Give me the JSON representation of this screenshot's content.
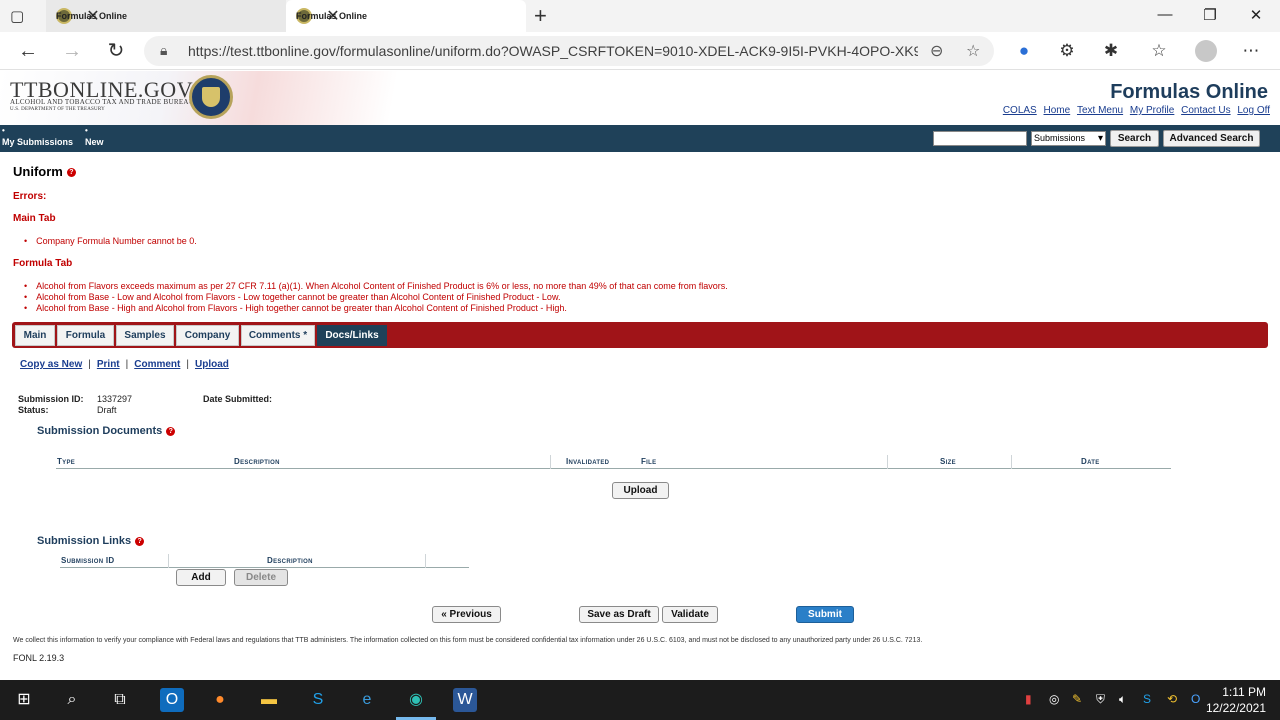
{
  "browser": {
    "tabs": [
      {
        "title": "Formulas Online"
      },
      {
        "title": "Formulas Online"
      }
    ],
    "url": "https://test.ttbonline.gov/formulasonline/uniform.do?OWASP_CSRFTOKEN=9010-XDEL-ACK9-9I5I-PVKH-4OPO-XK9..."
  },
  "header": {
    "logo": "TTBONLINE.GOV",
    "logo_sub1": "ALCOHOL AND TOBACCO TAX AND TRADE BUREAU",
    "logo_sub2": "U.S. DEPARTMENT OF THE TREASURY",
    "title": "Formulas Online",
    "links": [
      "COLAS",
      "Home",
      "Text Menu",
      "My Profile",
      "Contact Us",
      "Log Off"
    ]
  },
  "nav": {
    "items": [
      {
        "label": "My Submissions"
      },
      {
        "label": "New"
      }
    ],
    "search_select": "Submissions",
    "search_button": "Search",
    "advanced_search": "Advanced Search"
  },
  "page": {
    "title": "Uniform",
    "errors_heading": "Errors:",
    "main_tab_heading": "Main Tab",
    "main_errors": [
      "Company Formula Number cannot be 0."
    ],
    "formula_tab_heading": "Formula Tab",
    "formula_errors": [
      "Alcohol from Flavors exceeds maximum as per 27 CFR 7.11 (a)(1). When Alcohol Content of Finished Product is 6% or less, no more than 49% of that can come from flavors.",
      "Alcohol from Base - Low and Alcohol from Flavors - Low together cannot be greater than Alcohol Content of Finished Product - Low.",
      "Alcohol from Base - High and Alcohol from Flavors - High together cannot be greater than Alcohol Content of Finished Product - High."
    ],
    "tabs": [
      "Main",
      "Formula",
      "Samples",
      "Company",
      "Comments *",
      "Docs/Links"
    ],
    "actions": [
      "Copy as New",
      "Print",
      "Comment",
      "Upload"
    ],
    "submission_id_label": "Submission ID:",
    "submission_id": "1337297",
    "status_label": "Status:",
    "status": "Draft",
    "date_submitted_label": "Date Submitted:",
    "docs_title": "Submission Documents",
    "docs_columns": [
      "Type",
      "Description",
      "Invalidated",
      "File",
      "Size",
      "Date"
    ],
    "upload_button": "Upload",
    "links_title": "Submission Links",
    "links_columns": [
      "Submission ID",
      "Description"
    ],
    "add_button": "Add",
    "delete_button": "Delete",
    "previous_button": "« Previous",
    "save_draft_button": "Save as Draft",
    "validate_button": "Validate",
    "submit_button": "Submit",
    "footer_note": "We collect this information to verify your compliance with Federal laws and regulations that TTB administers. The information collected on this form must be considered confidential tax information under 26 U.S.C. 6103, and must not be disclosed to any unauthorized party under 26 U.S.C. 7213.",
    "version": "FONL 2.19.3"
  },
  "taskbar": {
    "time": "1:11 PM",
    "date": "12/22/2021"
  },
  "colors": {
    "nav_bg": "#1f4159",
    "tab_strip": "#a01418",
    "error": "#c00000",
    "title_blue": "#1e3d5c"
  }
}
